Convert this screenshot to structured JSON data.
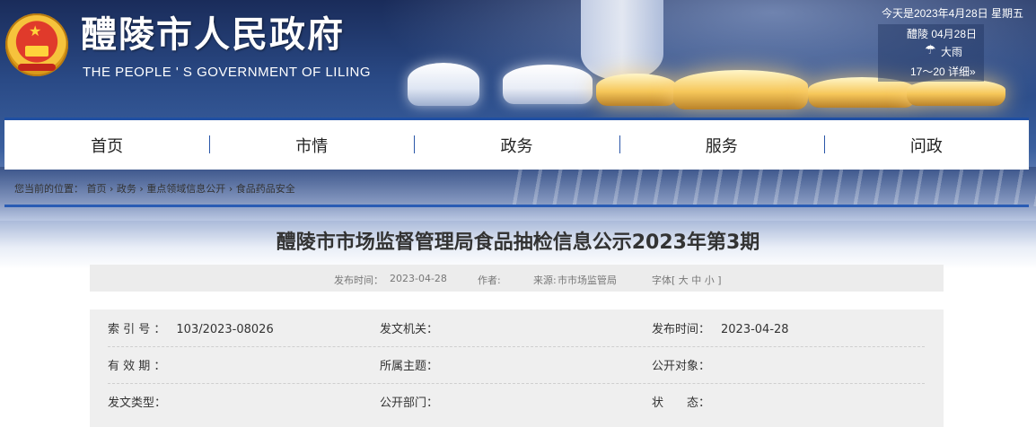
{
  "header": {
    "site_title": "醴陵市人民政府",
    "site_subtitle": "THE PEOPLE ' S GOVERNMENT OF LILING",
    "today": "今天是2023年4月28日 星期五",
    "weather": {
      "line1": "醴陵 04月28日",
      "condition": "大雨",
      "range": "17～20",
      "detail_label": "详细»",
      "icon": "rain-icon"
    }
  },
  "nav": {
    "items": [
      "首页",
      "市情",
      "政务",
      "服务",
      "问政"
    ]
  },
  "breadcrumb": {
    "prefix": "您当前的位置：",
    "items": [
      "首页",
      "政务",
      "重点领域信息公开",
      "食品药品安全"
    ],
    "separator": "›"
  },
  "article": {
    "title": "醴陵市市场监督管理局食品抽检信息公示2023年第3期",
    "meta": {
      "publish_time_label": "发布时间：",
      "publish_time": "2023-04-28",
      "author_label": "作者:",
      "source_label": "来源:",
      "source": "市市场监管局",
      "font_size_label": "字体[",
      "font_large": "大",
      "font_medium": "中",
      "font_small": "小",
      "font_size_close": "]"
    },
    "info": [
      [
        {
          "label": "索 引 号 ：",
          "value": "103/2023-08026"
        },
        {
          "label": "发文机关：",
          "value": ""
        },
        {
          "label": "发布时间：",
          "value": "2023-04-28"
        }
      ],
      [
        {
          "label": "有 效 期 ：",
          "value": ""
        },
        {
          "label": "所属主题：",
          "value": ""
        },
        {
          "label": "公开对象：",
          "value": ""
        }
      ],
      [
        {
          "label": "发文类型：",
          "value": ""
        },
        {
          "label": "公开部门：",
          "value": ""
        },
        {
          "label": "状　　态：",
          "value": ""
        }
      ]
    ]
  }
}
